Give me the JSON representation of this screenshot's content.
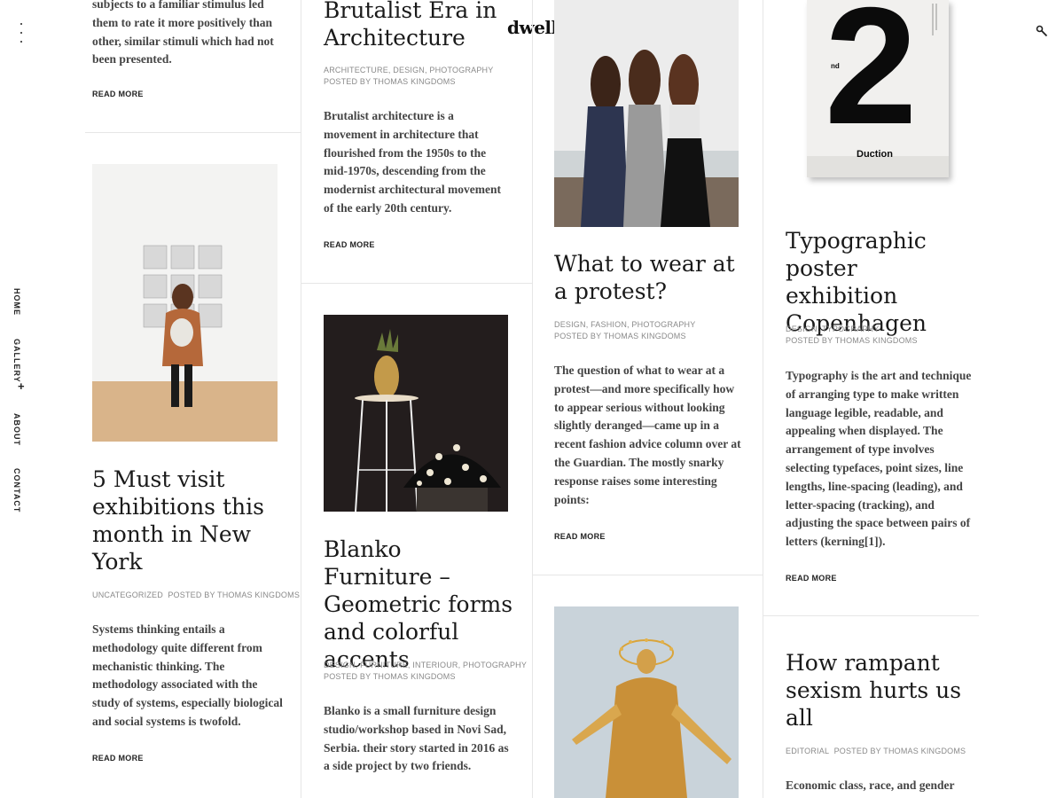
{
  "brand": {
    "logo": "dwell."
  },
  "nav": {
    "items": [
      {
        "label": "HOME"
      },
      {
        "label": "GALLERY"
      },
      {
        "label": "ABOUT"
      },
      {
        "label": "CONTACT"
      }
    ],
    "gallery_expand": "+"
  },
  "posts": {
    "top_left": {
      "excerpt": "subjects to a familiar stimulus led them to rate it more positively than other, similar stimuli which had not been presented.",
      "read_more": "READ MORE"
    },
    "exhibitions": {
      "title": "5 Must visit exhibitions this month in New York",
      "category": "UNCATEGORIZED",
      "posted_by": "POSTED BY THOMAS KINGDOMS",
      "excerpt": "Systems thinking entails a methodology quite different from mechanistic thinking. The methodology associated with the study of systems, especially biological and social systems is twofold.",
      "read_more": "READ MORE"
    },
    "brutalist": {
      "title": "Brutalist Era in Architecture",
      "categories": "ARCHITECTURE, DESIGN, PHOTOGRAPHY",
      "posted_by": "POSTED BY THOMAS KINGDOMS",
      "excerpt": "Brutalist architecture is a movement in architecture that flourished from the 1950s to the mid-1970s, descending from the modernist architectural movement of the early 20th century.",
      "read_more": "READ MORE"
    },
    "blanko": {
      "title": "Blanko Furniture – Geometric forms and colorful accents",
      "categories": "DESIGN, FURNITURE, INTERIOUR, PHOTOGRAPHY",
      "posted_by": "POSTED BY THOMAS KINGDOMS",
      "excerpt": "Blanko is a small furniture design studio/workshop based in Novi Sad, Serbia. their story started in 2016 as a side project by two friends."
    },
    "protest": {
      "title": "What to wear at a protest?",
      "categories": "DESIGN, FASHION, PHOTOGRAPHY",
      "posted_by": "POSTED BY THOMAS KINGDOMS",
      "excerpt": "The question of what to wear at a protest—and more specifically how to appear serious without looking slightly deranged—came up in a recent fashion advice column over at the Guardian. The mostly snarky response raises some interesting points:",
      "read_more": "READ MORE"
    },
    "typographic": {
      "title": "Typographic poster exhibition Copenhagen",
      "categories": "DESIGN, TYPOGRAPHY",
      "posted_by": "POSTED BY THOMAS KINGDOMS",
      "excerpt": "Typography is the art and technique of arranging type to make written language legible, readable, and appealing when displayed. The arrangement of type involves selecting typefaces, point sizes, line lengths, line-spacing (leading), and letter-spacing (tracking), and adjusting the space between pairs of letters (kerning[1]).",
      "read_more": "READ MORE",
      "poster_number": "2",
      "poster_small": "nd",
      "poster_bottom": "Duction"
    },
    "sexism": {
      "title": "How rampant sexism hurts us all",
      "category": "EDITORIAL",
      "posted_by": "POSTED BY THOMAS KINGDOMS",
      "excerpt": "Economic class, race, and gender"
    }
  },
  "colors": {
    "accent": "#111111",
    "meta": "#8a8a8a",
    "divider": "#e6e6e6"
  }
}
